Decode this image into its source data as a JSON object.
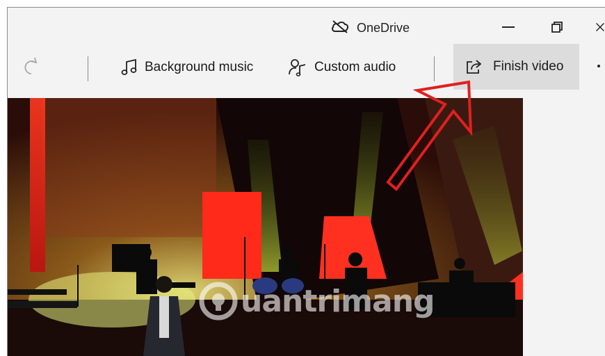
{
  "window": {
    "title": "OneDrive",
    "title_icon": "cloud-off-icon",
    "minimize_icon": "minimize-icon",
    "restore_icon": "restore-icon",
    "close_icon": "close-icon"
  },
  "toolbar": {
    "redo_icon": "redo-icon",
    "background_music_label": "Background music",
    "background_music_icon": "music-note-icon",
    "custom_audio_label": "Custom audio",
    "custom_audio_icon": "person-audio-icon",
    "finish_video_label": "Finish video",
    "finish_video_icon": "share-export-icon",
    "more_icon": "more-options-icon"
  },
  "annotation": {
    "arrow_color": "#e02020"
  },
  "video": {
    "watermark_text": "uantrimang",
    "watermark_icon": "lightbulb-logo"
  },
  "colors": {
    "titlebar_bg": "#f3f3f3",
    "finish_button_bg": "#dcdcdc",
    "stage_red": "#ff2a1a",
    "stage_green": "#c8e040"
  }
}
